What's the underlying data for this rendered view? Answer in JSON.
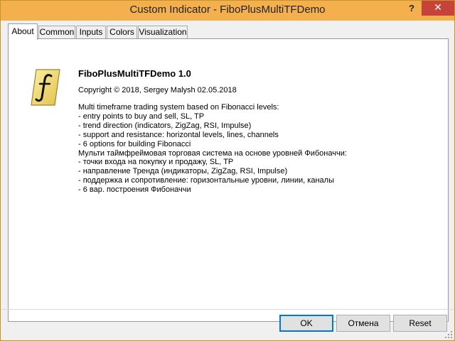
{
  "window": {
    "title": "Custom Indicator - FiboPlusMultiTFDemo",
    "help_label": "?",
    "close_label": "✕"
  },
  "tabs": [
    {
      "label": "About",
      "active": true
    },
    {
      "label": "Common",
      "active": false
    },
    {
      "label": "Inputs",
      "active": false
    },
    {
      "label": "Colors",
      "active": false
    },
    {
      "label": "Visualization",
      "active": false
    }
  ],
  "about": {
    "icon": "fibonacci-script-f-icon",
    "name": "FiboPlusMultiTFDemo 1.0",
    "copyright": "Copyright © 2018, Sergey Malysh 02.05.2018",
    "description": [
      "Multi timeframe trading system based on Fibonacci levels:",
      "- entry points to buy and sell, SL, TP",
      "- trend direction (indicators, ZigZag, RSI, Impulse)",
      "- support and resistance: horizontal levels, lines, channels",
      "- 6 options for building Fibonacci",
      "Мульти таймфреймовая торговая система на основе уровней Фибоначчи:",
      "- точки входа на покупку и продажу, SL, TP",
      "- направление Тренда (индикаторы, ZigZag, RSI, Impulse)",
      "- поддержка и сопротивление: горизонтальные уровни, линии, каналы",
      "- 6 вар. построения Фибоначчи"
    ]
  },
  "buttons": {
    "ok": "OK",
    "cancel": "Отмена",
    "reset": "Reset"
  },
  "colors": {
    "titlebar": "#f5b04e",
    "close": "#c7433a",
    "icon_fill": "#f3df70"
  }
}
